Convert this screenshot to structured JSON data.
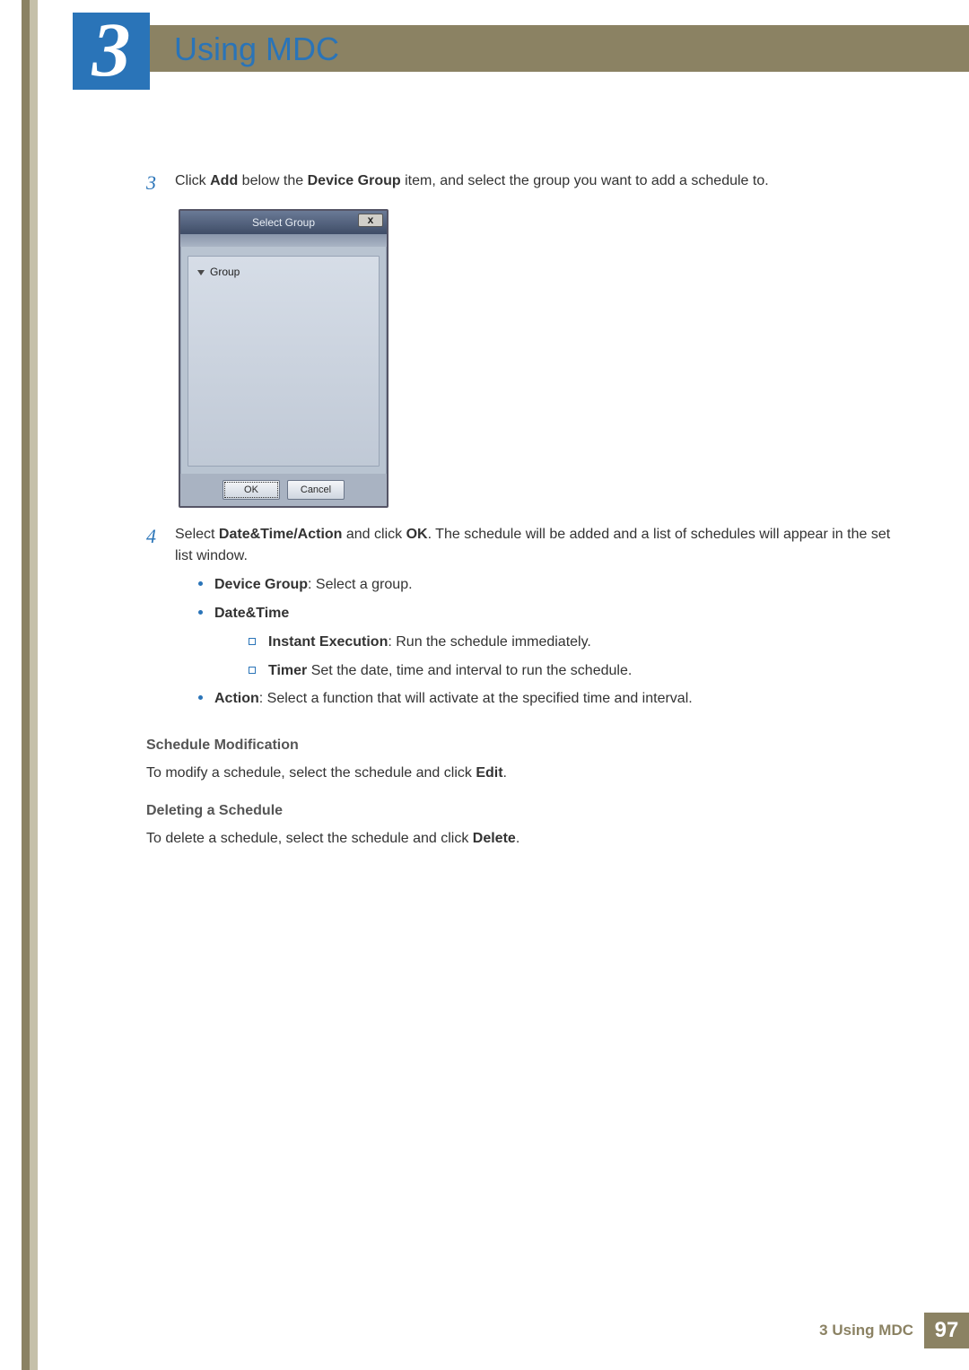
{
  "header": {
    "chapter_number": "3",
    "chapter_title": "Using MDC"
  },
  "steps": {
    "s3": {
      "num": "3",
      "pre": "Click ",
      "add": "Add",
      "mid1": " below the ",
      "dg": "Device Group",
      "post": " item, and select the group you want to add a schedule to."
    },
    "s4": {
      "num": "4",
      "pre": "Select ",
      "dta": "Date&Time/Action",
      "mid1": " and click ",
      "ok": "OK",
      "post": ". The schedule will be added and a list of schedules will appear in the set list window."
    }
  },
  "dialog": {
    "title": "Select Group",
    "tree_root": "Group",
    "ok_label": "OK",
    "cancel_label": "Cancel",
    "close_glyph": "x"
  },
  "bullets": {
    "device_group_label": "Device Group",
    "device_group_text": ": Select a group.",
    "datetime_label": "Date&Time",
    "instant_label": "Instant Execution",
    "instant_text": ": Run the schedule immediately.",
    "timer_label": "Timer",
    "timer_text": " Set the date, time and interval to run the schedule.",
    "action_label": "Action",
    "action_text": ": Select a function that will activate at the specified time and interval."
  },
  "sections": {
    "sched_mod_h": "Schedule Modification",
    "sched_mod_p_pre": "To modify a schedule, select the schedule and click ",
    "sched_mod_edit": "Edit",
    "sched_mod_p_post": ".",
    "del_h": "Deleting a Schedule",
    "del_p_pre": "To delete a schedule, select the schedule and click ",
    "del_delete": "Delete",
    "del_p_post": "."
  },
  "footer": {
    "text": "3 Using MDC",
    "page": "97"
  }
}
